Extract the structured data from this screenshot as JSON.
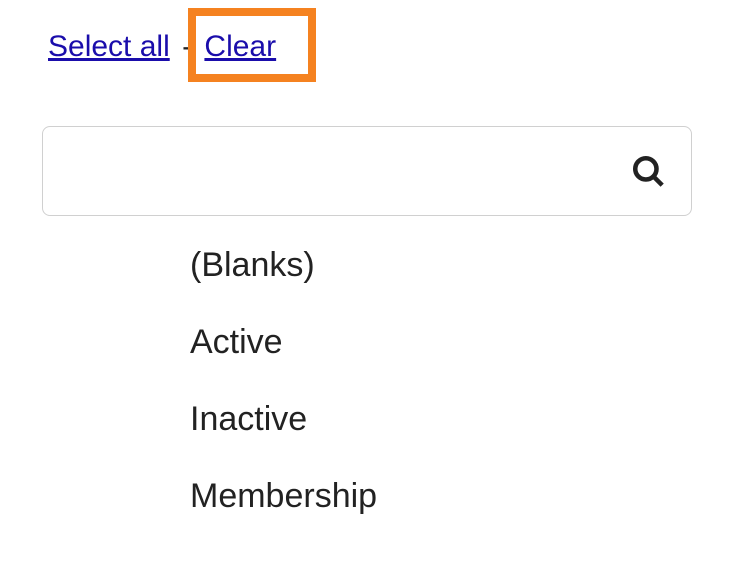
{
  "topLinks": {
    "selectAll": "Select all",
    "separator": "-",
    "clear": "Clear"
  },
  "search": {
    "placeholder": ""
  },
  "filterOptions": [
    {
      "label": "(Blanks)"
    },
    {
      "label": "Active"
    },
    {
      "label": "Inactive"
    },
    {
      "label": "Membership"
    }
  ]
}
